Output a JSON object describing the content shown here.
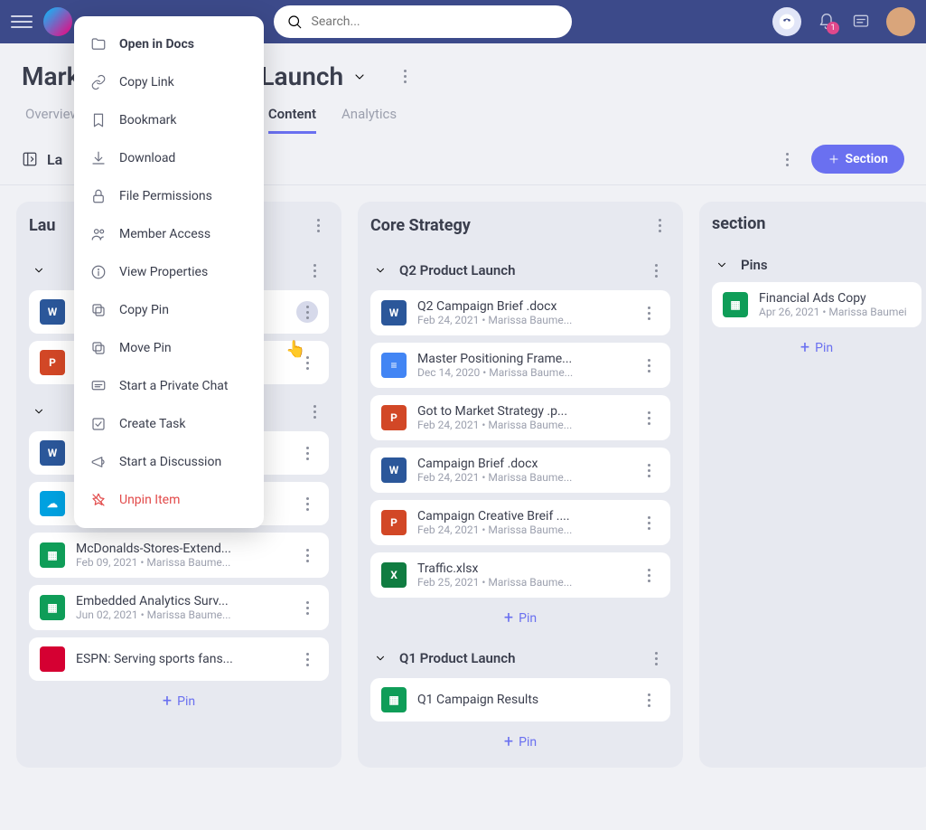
{
  "header": {
    "search_placeholder": "Search...",
    "notification_count": "1"
  },
  "page": {
    "title_partial_left": "Mark",
    "title_partial_right": "Launch",
    "tabs": {
      "overview": "Overview",
      "content": "Content",
      "analytics": "Analytics"
    },
    "subbar_label": "La",
    "section_button": "Section"
  },
  "columns": [
    {
      "title": "Lau",
      "groups": [
        {
          "title": "",
          "cards": [
            {
              "icon": "word",
              "title": "",
              "meta": ""
            },
            {
              "icon": "ppt",
              "title": "",
              "meta": ""
            }
          ]
        },
        {
          "title": "",
          "cards": [
            {
              "icon": "word",
              "title": "",
              "meta": ""
            },
            {
              "icon": "sf",
              "title": "",
              "meta": ""
            },
            {
              "icon": "sheets",
              "title": "McDonalds-Stores-Extend...",
              "meta": "Feb 09, 2021 • Marissa Baume..."
            },
            {
              "icon": "sheets",
              "title": "Embedded Analytics Surv...",
              "meta": "Jun 02, 2021 • Marissa Baume..."
            },
            {
              "icon": "espn",
              "title": "ESPN: Serving sports fans...",
              "meta": ""
            }
          ]
        }
      ],
      "pin_label": "Pin"
    },
    {
      "title": "Core Strategy",
      "groups": [
        {
          "title": "Q2 Product Launch",
          "cards": [
            {
              "icon": "word",
              "title": "Q2 Campaign Brief .docx",
              "meta": "Feb 24, 2021 • Marissa Baume..."
            },
            {
              "icon": "gdoc",
              "title": "Master Positioning Frame...",
              "meta": "Dec 14, 2020 • Marissa Baume..."
            },
            {
              "icon": "ppt",
              "title": "Got to Market Strategy .p...",
              "meta": "Feb 24, 2021 • Marissa Baume..."
            },
            {
              "icon": "word",
              "title": "Campaign Brief .docx",
              "meta": "Feb 24, 2021 • Marissa Baume..."
            },
            {
              "icon": "ppt",
              "title": "Campaign Creative Breif ....",
              "meta": "Feb 24, 2021 • Marissa Baume..."
            },
            {
              "icon": "xlsx",
              "title": "Traffic.xlsx",
              "meta": "Feb 25, 2021 • Marissa Baume..."
            }
          ],
          "pin_label": "Pin"
        },
        {
          "title": "Q1 Product Launch",
          "cards": [
            {
              "icon": "sheets",
              "title": "Q1 Campaign Results",
              "meta": ""
            }
          ],
          "pin_label": "Pin"
        }
      ]
    },
    {
      "title": "section",
      "groups": [
        {
          "title": "Pins",
          "cards": [
            {
              "icon": "sheets",
              "title": "Financial Ads Copy",
              "meta": "Apr 26, 2021 • Marissa Baumei"
            }
          ],
          "pin_label": "Pin"
        }
      ]
    }
  ],
  "context_menu": {
    "open_in_docs": "Open in Docs",
    "copy_link": "Copy Link",
    "bookmark": "Bookmark",
    "download": "Download",
    "file_permissions": "File Permissions",
    "member_access": "Member Access",
    "view_properties": "View Properties",
    "copy_pin": "Copy Pin",
    "move_pin": "Move Pin",
    "start_private_chat": "Start a Private Chat",
    "create_task": "Create Task",
    "start_discussion": "Start a Discussion",
    "unpin_item": "Unpin Item"
  }
}
